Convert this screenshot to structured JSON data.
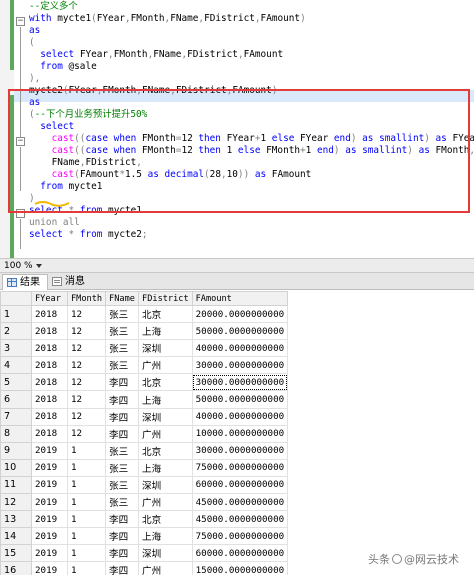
{
  "editor": {
    "lines": [
      [
        {
          "t": "--定义多个",
          "c": "c"
        }
      ],
      [
        {
          "t": "with ",
          "c": "k"
        },
        {
          "t": "mycte1",
          "c": "n"
        },
        {
          "t": "(",
          "c": "g"
        },
        {
          "t": "FYear",
          "c": "n"
        },
        {
          "t": ",",
          "c": "g"
        },
        {
          "t": "FMonth",
          "c": "n"
        },
        {
          "t": ",",
          "c": "g"
        },
        {
          "t": "FName",
          "c": "n"
        },
        {
          "t": ",",
          "c": "g"
        },
        {
          "t": "FDistrict",
          "c": "n"
        },
        {
          "t": ",",
          "c": "g"
        },
        {
          "t": "FAmount",
          "c": "n"
        },
        {
          "t": ")",
          "c": "g"
        }
      ],
      [
        {
          "t": "as",
          "c": "k"
        }
      ],
      [
        {
          "t": "(",
          "c": "g"
        }
      ],
      [
        {
          "t": "  select ",
          "c": "k"
        },
        {
          "t": "FYear",
          "c": "n"
        },
        {
          "t": ",",
          "c": "g"
        },
        {
          "t": "FMonth",
          "c": "n"
        },
        {
          "t": ",",
          "c": "g"
        },
        {
          "t": "FName",
          "c": "n"
        },
        {
          "t": ",",
          "c": "g"
        },
        {
          "t": "FDistrict",
          "c": "n"
        },
        {
          "t": ",",
          "c": "g"
        },
        {
          "t": "FAmount",
          "c": "n"
        }
      ],
      [
        {
          "t": "  from ",
          "c": "k"
        },
        {
          "t": "@sale",
          "c": "n"
        }
      ],
      [
        {
          "t": "),",
          "c": "g"
        }
      ],
      [
        {
          "t": "mycte2",
          "c": "n"
        },
        {
          "t": "(",
          "c": "g"
        },
        {
          "t": "FYear",
          "c": "n"
        },
        {
          "t": ",",
          "c": "g"
        },
        {
          "t": "FMonth",
          "c": "n"
        },
        {
          "t": ",",
          "c": "g"
        },
        {
          "t": "FName",
          "c": "n"
        },
        {
          "t": ",",
          "c": "g"
        },
        {
          "t": "FDistrict",
          "c": "n"
        },
        {
          "t": ",",
          "c": "g"
        },
        {
          "t": "FAmount",
          "c": "n"
        },
        {
          "t": ")",
          "c": "g"
        }
      ],
      [
        {
          "t": "as",
          "c": "k"
        }
      ],
      [
        {
          "t": "(",
          "c": "g"
        },
        {
          "t": "--下个月业务预计提升50%",
          "c": "c"
        }
      ],
      [
        {
          "t": "  select",
          "c": "k"
        }
      ],
      [
        {
          "t": "    ",
          "c": "n"
        },
        {
          "t": "cast",
          "c": "f"
        },
        {
          "t": "((",
          "c": "g"
        },
        {
          "t": "case when ",
          "c": "k"
        },
        {
          "t": "FMonth",
          "c": "n"
        },
        {
          "t": "=",
          "c": "g"
        },
        {
          "t": "12 ",
          "c": "n"
        },
        {
          "t": "then ",
          "c": "k"
        },
        {
          "t": "FYear",
          "c": "n"
        },
        {
          "t": "+",
          "c": "g"
        },
        {
          "t": "1 ",
          "c": "n"
        },
        {
          "t": "else ",
          "c": "k"
        },
        {
          "t": "FYear ",
          "c": "n"
        },
        {
          "t": "end",
          "c": "k"
        },
        {
          "t": ") ",
          "c": "g"
        },
        {
          "t": "as ",
          "c": "k"
        },
        {
          "t": "smallint",
          "c": "k"
        },
        {
          "t": ") ",
          "c": "g"
        },
        {
          "t": "as ",
          "c": "k"
        },
        {
          "t": "FYear",
          "c": "n"
        },
        {
          "t": ",",
          "c": "g"
        }
      ],
      [
        {
          "t": "    ",
          "c": "n"
        },
        {
          "t": "cast",
          "c": "f"
        },
        {
          "t": "((",
          "c": "g"
        },
        {
          "t": "case when ",
          "c": "k"
        },
        {
          "t": "FMonth",
          "c": "n"
        },
        {
          "t": "=",
          "c": "g"
        },
        {
          "t": "12 ",
          "c": "n"
        },
        {
          "t": "then ",
          "c": "k"
        },
        {
          "t": "1 ",
          "c": "n"
        },
        {
          "t": "else ",
          "c": "k"
        },
        {
          "t": "FMonth",
          "c": "n"
        },
        {
          "t": "+",
          "c": "g"
        },
        {
          "t": "1 ",
          "c": "n"
        },
        {
          "t": "end",
          "c": "k"
        },
        {
          "t": ") ",
          "c": "g"
        },
        {
          "t": "as ",
          "c": "k"
        },
        {
          "t": "smallint",
          "c": "k"
        },
        {
          "t": ") ",
          "c": "g"
        },
        {
          "t": "as ",
          "c": "k"
        },
        {
          "t": "FMonth",
          "c": "n"
        },
        {
          "t": ",",
          "c": "g"
        }
      ],
      [
        {
          "t": "    FName",
          "c": "n"
        },
        {
          "t": ",",
          "c": "g"
        },
        {
          "t": "FDistrict",
          "c": "n"
        },
        {
          "t": ",",
          "c": "g"
        }
      ],
      [
        {
          "t": "    ",
          "c": "n"
        },
        {
          "t": "cast",
          "c": "f"
        },
        {
          "t": "(",
          "c": "g"
        },
        {
          "t": "FAmount",
          "c": "n"
        },
        {
          "t": "*",
          "c": "g"
        },
        {
          "t": "1.5 ",
          "c": "n"
        },
        {
          "t": "as ",
          "c": "k"
        },
        {
          "t": "decimal",
          "c": "k"
        },
        {
          "t": "(",
          "c": "g"
        },
        {
          "t": "28",
          "c": "n"
        },
        {
          "t": ",",
          "c": "g"
        },
        {
          "t": "10",
          "c": "n"
        },
        {
          "t": ")) ",
          "c": "g"
        },
        {
          "t": "as ",
          "c": "k"
        },
        {
          "t": "FAmount",
          "c": "n"
        }
      ],
      [
        {
          "t": "  from ",
          "c": "k"
        },
        {
          "t": "mycte1",
          "c": "n"
        }
      ],
      [
        {
          "t": ")",
          "c": "g"
        }
      ],
      [
        {
          "t": "select ",
          "c": "k"
        },
        {
          "t": "* ",
          "c": "g"
        },
        {
          "t": "from ",
          "c": "k"
        },
        {
          "t": "mycte1",
          "c": "n"
        }
      ],
      [
        {
          "t": "union all",
          "c": "g"
        }
      ],
      [
        {
          "t": "select ",
          "c": "k"
        },
        {
          "t": "* ",
          "c": "g"
        },
        {
          "t": "from ",
          "c": "k"
        },
        {
          "t": "mycte2",
          "c": "n"
        },
        {
          "t": ";",
          "c": "g"
        }
      ]
    ]
  },
  "zoom": {
    "value": "100 %"
  },
  "tabs": {
    "results": "结果",
    "messages": "消息"
  },
  "grid": {
    "columns": [
      "FYear",
      "FMonth",
      "FName",
      "FDistrict",
      "FAmount"
    ],
    "rows": [
      [
        "1",
        "2018",
        "12",
        "张三",
        "北京",
        "20000.0000000000"
      ],
      [
        "2",
        "2018",
        "12",
        "张三",
        "上海",
        "50000.0000000000"
      ],
      [
        "3",
        "2018",
        "12",
        "张三",
        "深圳",
        "40000.0000000000"
      ],
      [
        "4",
        "2018",
        "12",
        "张三",
        "广州",
        "30000.0000000000"
      ],
      [
        "5",
        "2018",
        "12",
        "李四",
        "北京",
        "30000.0000000000"
      ],
      [
        "6",
        "2018",
        "12",
        "李四",
        "上海",
        "50000.0000000000"
      ],
      [
        "7",
        "2018",
        "12",
        "李四",
        "深圳",
        "40000.0000000000"
      ],
      [
        "8",
        "2018",
        "12",
        "李四",
        "广州",
        "10000.0000000000"
      ],
      [
        "9",
        "2019",
        "1",
        "张三",
        "北京",
        "30000.0000000000"
      ],
      [
        "10",
        "2019",
        "1",
        "张三",
        "上海",
        "75000.0000000000"
      ],
      [
        "11",
        "2019",
        "1",
        "张三",
        "深圳",
        "60000.0000000000"
      ],
      [
        "12",
        "2019",
        "1",
        "张三",
        "广州",
        "45000.0000000000"
      ],
      [
        "13",
        "2019",
        "1",
        "李四",
        "北京",
        "45000.0000000000"
      ],
      [
        "14",
        "2019",
        "1",
        "李四",
        "上海",
        "75000.0000000000"
      ],
      [
        "15",
        "2019",
        "1",
        "李四",
        "深圳",
        "60000.0000000000"
      ],
      [
        "16",
        "2019",
        "1",
        "李四",
        "广州",
        "15000.0000000000"
      ]
    ]
  },
  "watermark": {
    "prefix": "头条",
    "brand": "@网云技术"
  },
  "colors": {
    "keyword": "#0000ff",
    "comment": "#008000",
    "function": "#ff00ff",
    "highlight_box": "#e33a3a"
  }
}
